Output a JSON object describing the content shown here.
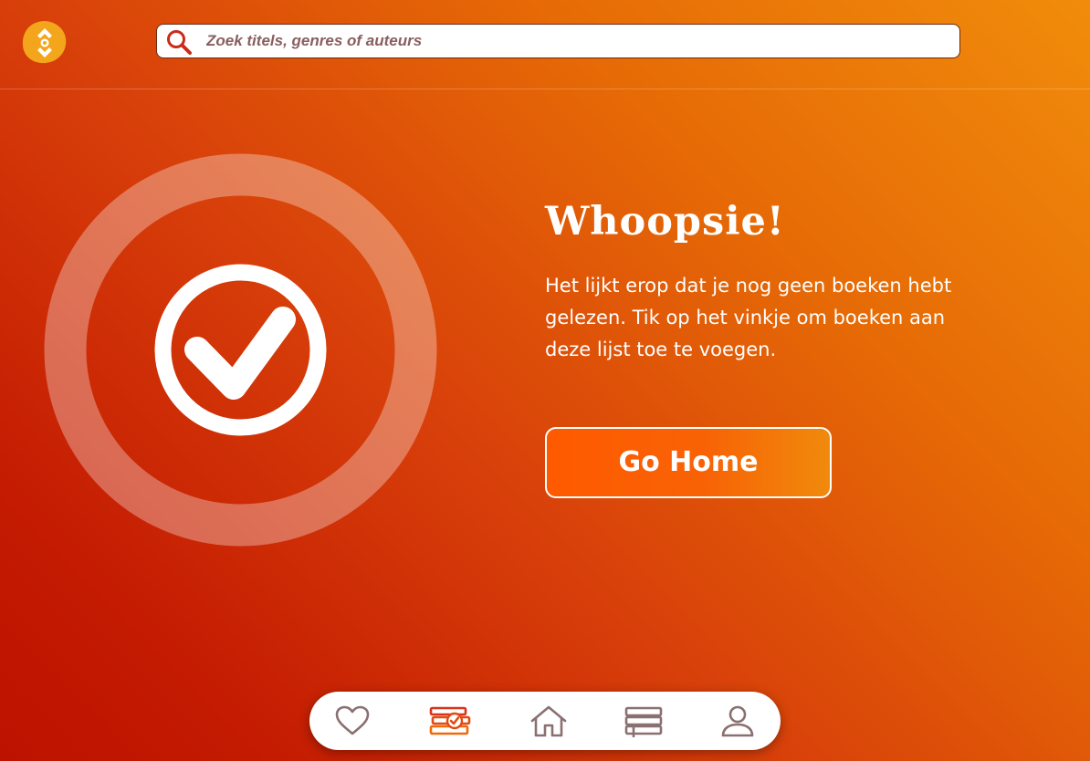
{
  "header": {
    "logo_icon": "app-logo-icon",
    "search": {
      "placeholder": "Zoek titels, genres of auteurs",
      "value": "",
      "icon": "search-icon"
    }
  },
  "empty_state": {
    "illustration_icon": "checkmark-circle-icon",
    "title": "Whoopsie!",
    "message": "Het lijkt erop dat je nog geen boeken hebt gelezen. Tik op het vinkje om boeken aan deze lijst toe te voegen.",
    "button_label": "Go Home"
  },
  "bottom_nav": {
    "items": [
      {
        "name": "favorites",
        "icon": "heart-icon",
        "active": false
      },
      {
        "name": "read",
        "icon": "books-check-icon",
        "active": true
      },
      {
        "name": "home",
        "icon": "home-icon",
        "active": false
      },
      {
        "name": "library",
        "icon": "bookshelf-icon",
        "active": false
      },
      {
        "name": "profile",
        "icon": "user-icon",
        "active": false
      }
    ]
  },
  "colors": {
    "gradient_light": "#f18c0b",
    "gradient_dark": "#bd1200",
    "button_orange": "#ff5a00",
    "nav_inactive": "#8a7070",
    "nav_active": "#e44a10"
  }
}
